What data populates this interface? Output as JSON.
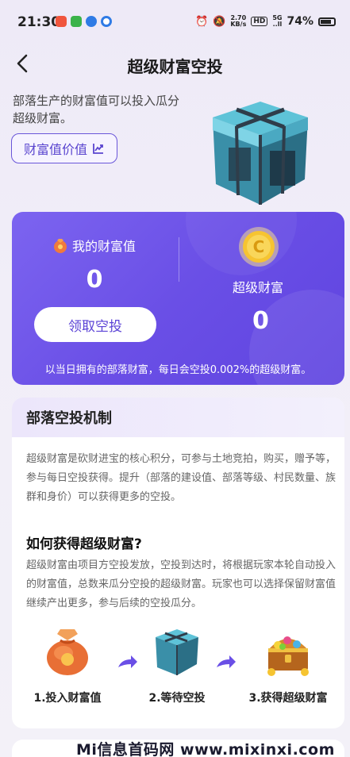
{
  "status": {
    "time": "21:30",
    "speed_top": "2.70",
    "speed_bottom": "KB/s",
    "hd": "HD",
    "net_top": "5G",
    "net_bottom": "..ll",
    "battery": "74%"
  },
  "nav": {
    "title": "超级财富空投"
  },
  "intro": {
    "text": "部落生产的财富值可以投入瓜分超级财富。",
    "value_button": "财富值价值"
  },
  "wealth": {
    "my_label": "我的财富值",
    "my_value": "0",
    "claim_button": "领取空投",
    "super_label": "超级财富",
    "super_value": "0",
    "note": "以当日拥有的部落财富，每日会空投0.002%的超级财富。"
  },
  "mechanism": {
    "header": "部落空投机制",
    "para1": "超级财富是砍财进宝的核心积分，可参与土地竞拍，购买，赠予等，参与每日空投获得。提升（部落的建设值、部落等级、村民数量、族群和身价）可以获得更多的空投。",
    "how_title": "如何获得超级财富?",
    "para2": "超级财富由项目方空投发放，空投到达时，将根据玩家本轮自动投入的财富值，总数来瓜分空投的超级财富。玩家也可以选择保留财富值继续产出更多，参与后续的空投瓜分。",
    "steps": [
      {
        "label": "1.投入财富值",
        "icon": "money-bag-icon"
      },
      {
        "label": "2.等待空投",
        "icon": "airdrop-crate-icon"
      },
      {
        "label": "3.获得超级财富",
        "icon": "treasure-chest-icon"
      }
    ]
  },
  "watermark": "Mi信息首码网 www.mixinxi.com",
  "colors": {
    "accent": "#6a4fe6",
    "card_bg": "#ffffff",
    "page_bg": "#eeeaf7"
  }
}
